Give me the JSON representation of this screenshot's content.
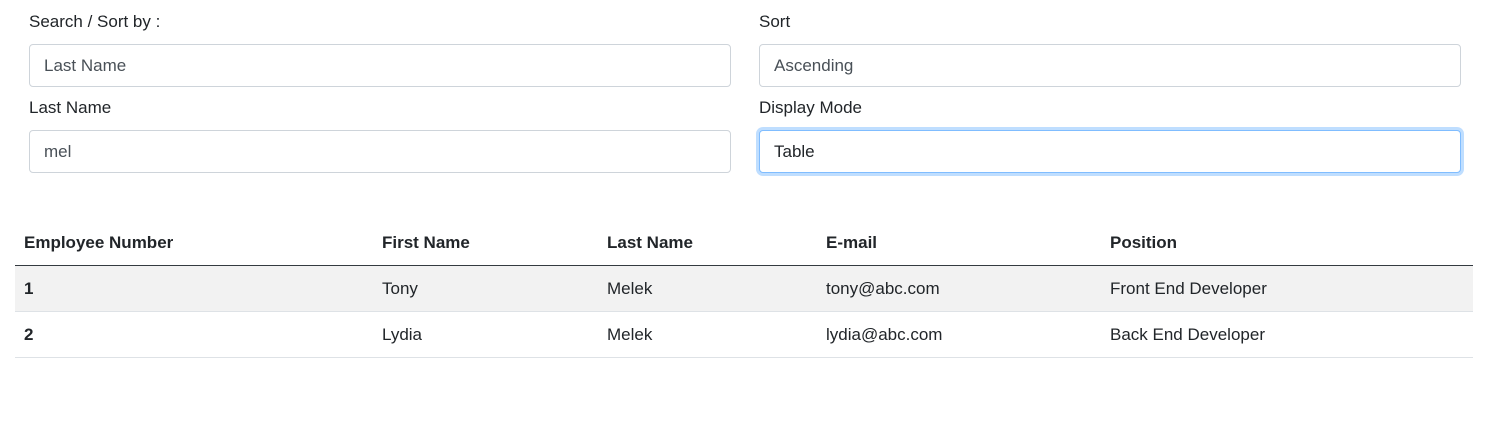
{
  "filters": {
    "search_sort_by": {
      "label": "Search / Sort by :",
      "value": "Last Name"
    },
    "sort": {
      "label": "Sort",
      "value": "Ascending"
    },
    "last_name": {
      "label": "Last Name",
      "value": "mel"
    },
    "display_mode": {
      "label": "Display Mode",
      "value": "Table"
    }
  },
  "table": {
    "headers": [
      "Employee Number",
      "First Name",
      "Last Name",
      "E-mail",
      "Position"
    ],
    "rows": [
      [
        "1",
        "Tony",
        "Melek",
        "tony@abc.com",
        "Front End Developer"
      ],
      [
        "2",
        "Lydia",
        "Melek",
        "lydia@abc.com",
        "Back End Developer"
      ]
    ]
  },
  "colors": {
    "focus_border": "#80bdff",
    "stripe": "#f2f2f2"
  }
}
